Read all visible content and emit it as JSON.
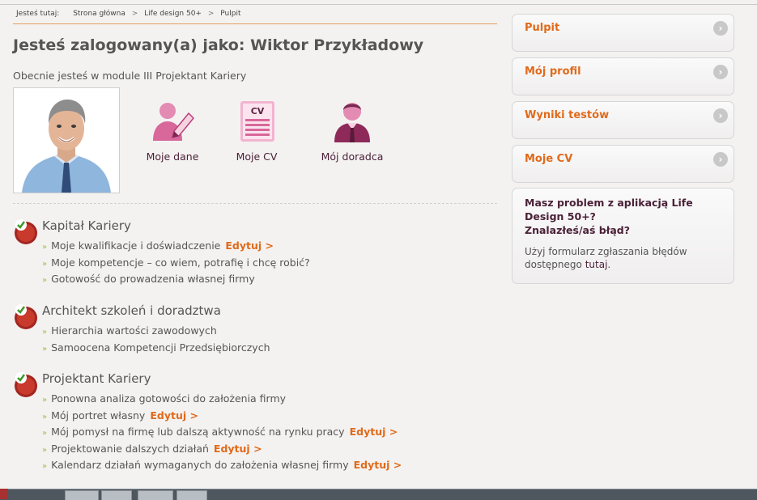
{
  "breadcrumb": {
    "label": "Jesteś tutaj:",
    "items": [
      "Strona główna",
      "Life design 50+",
      "Pulpit"
    ],
    "separator": ">"
  },
  "page_title": "Jesteś zalogowany(a) jako: Wiktor Przykładowy",
  "module_info": "Obecnie jesteś w module III Projektant Kariery",
  "quick_links": [
    {
      "label": "Moje dane",
      "icon": "user-edit-icon"
    },
    {
      "label": "Moje CV",
      "icon": "cv-document-icon",
      "icon_text": "CV"
    },
    {
      "label": "Mój doradca",
      "icon": "advisor-icon"
    }
  ],
  "sections": [
    {
      "title": "Kapitał Kariery",
      "icon": "completed-check-icon",
      "items": [
        {
          "text": "Moje kwalifikacje i doświadczenie",
          "edit": "Edytuj >"
        },
        {
          "text": "Moje kompetencje – co wiem, potrafię i chcę robić?"
        },
        {
          "text": "Gotowość do prowadzenia własnej firmy"
        }
      ]
    },
    {
      "title": "Architekt szkoleń i doradztwa",
      "icon": "completed-check-icon",
      "items": [
        {
          "text": "Hierarchia wartości zawodowych"
        },
        {
          "text": "Samoocena Kompetencji Przedsiębiorczych"
        }
      ]
    },
    {
      "title": "Projektant Kariery",
      "icon": "completed-check-icon",
      "items": [
        {
          "text": "Ponowna analiza gotowości do założenia firmy"
        },
        {
          "text": "Mój portret własny",
          "edit": "Edytuj >"
        },
        {
          "text": "Mój pomysł na firmę lub dalszą aktywność na rynku pracy",
          "edit": "Edytuj >"
        },
        {
          "text": "Projektowanie dalszych działań",
          "edit": "Edytuj >"
        },
        {
          "text": "Kalendarz działań wymaganych do założenia własnej firmy",
          "edit": "Edytuj >"
        }
      ]
    }
  ],
  "sidebar": {
    "items": [
      {
        "label": "Pulpit"
      },
      {
        "label": "Mój profil"
      },
      {
        "label": "Wyniki testów"
      },
      {
        "label": "Moje CV"
      }
    ],
    "arrow_glyph": "›"
  },
  "help": {
    "title_line1": "Masz problem z aplikacją Life Design 50+?",
    "title_line2": "Znalazłeś/aś błąd?",
    "text_before": "Użyj formularz zgłaszania błędów dostępnego",
    "link": "tutaj",
    "text_after": "."
  },
  "colors": {
    "accent": "#e06a1a",
    "plum": "#4a2138",
    "bullet": "#9cbd3c",
    "icon_pink": "#d8679a"
  }
}
